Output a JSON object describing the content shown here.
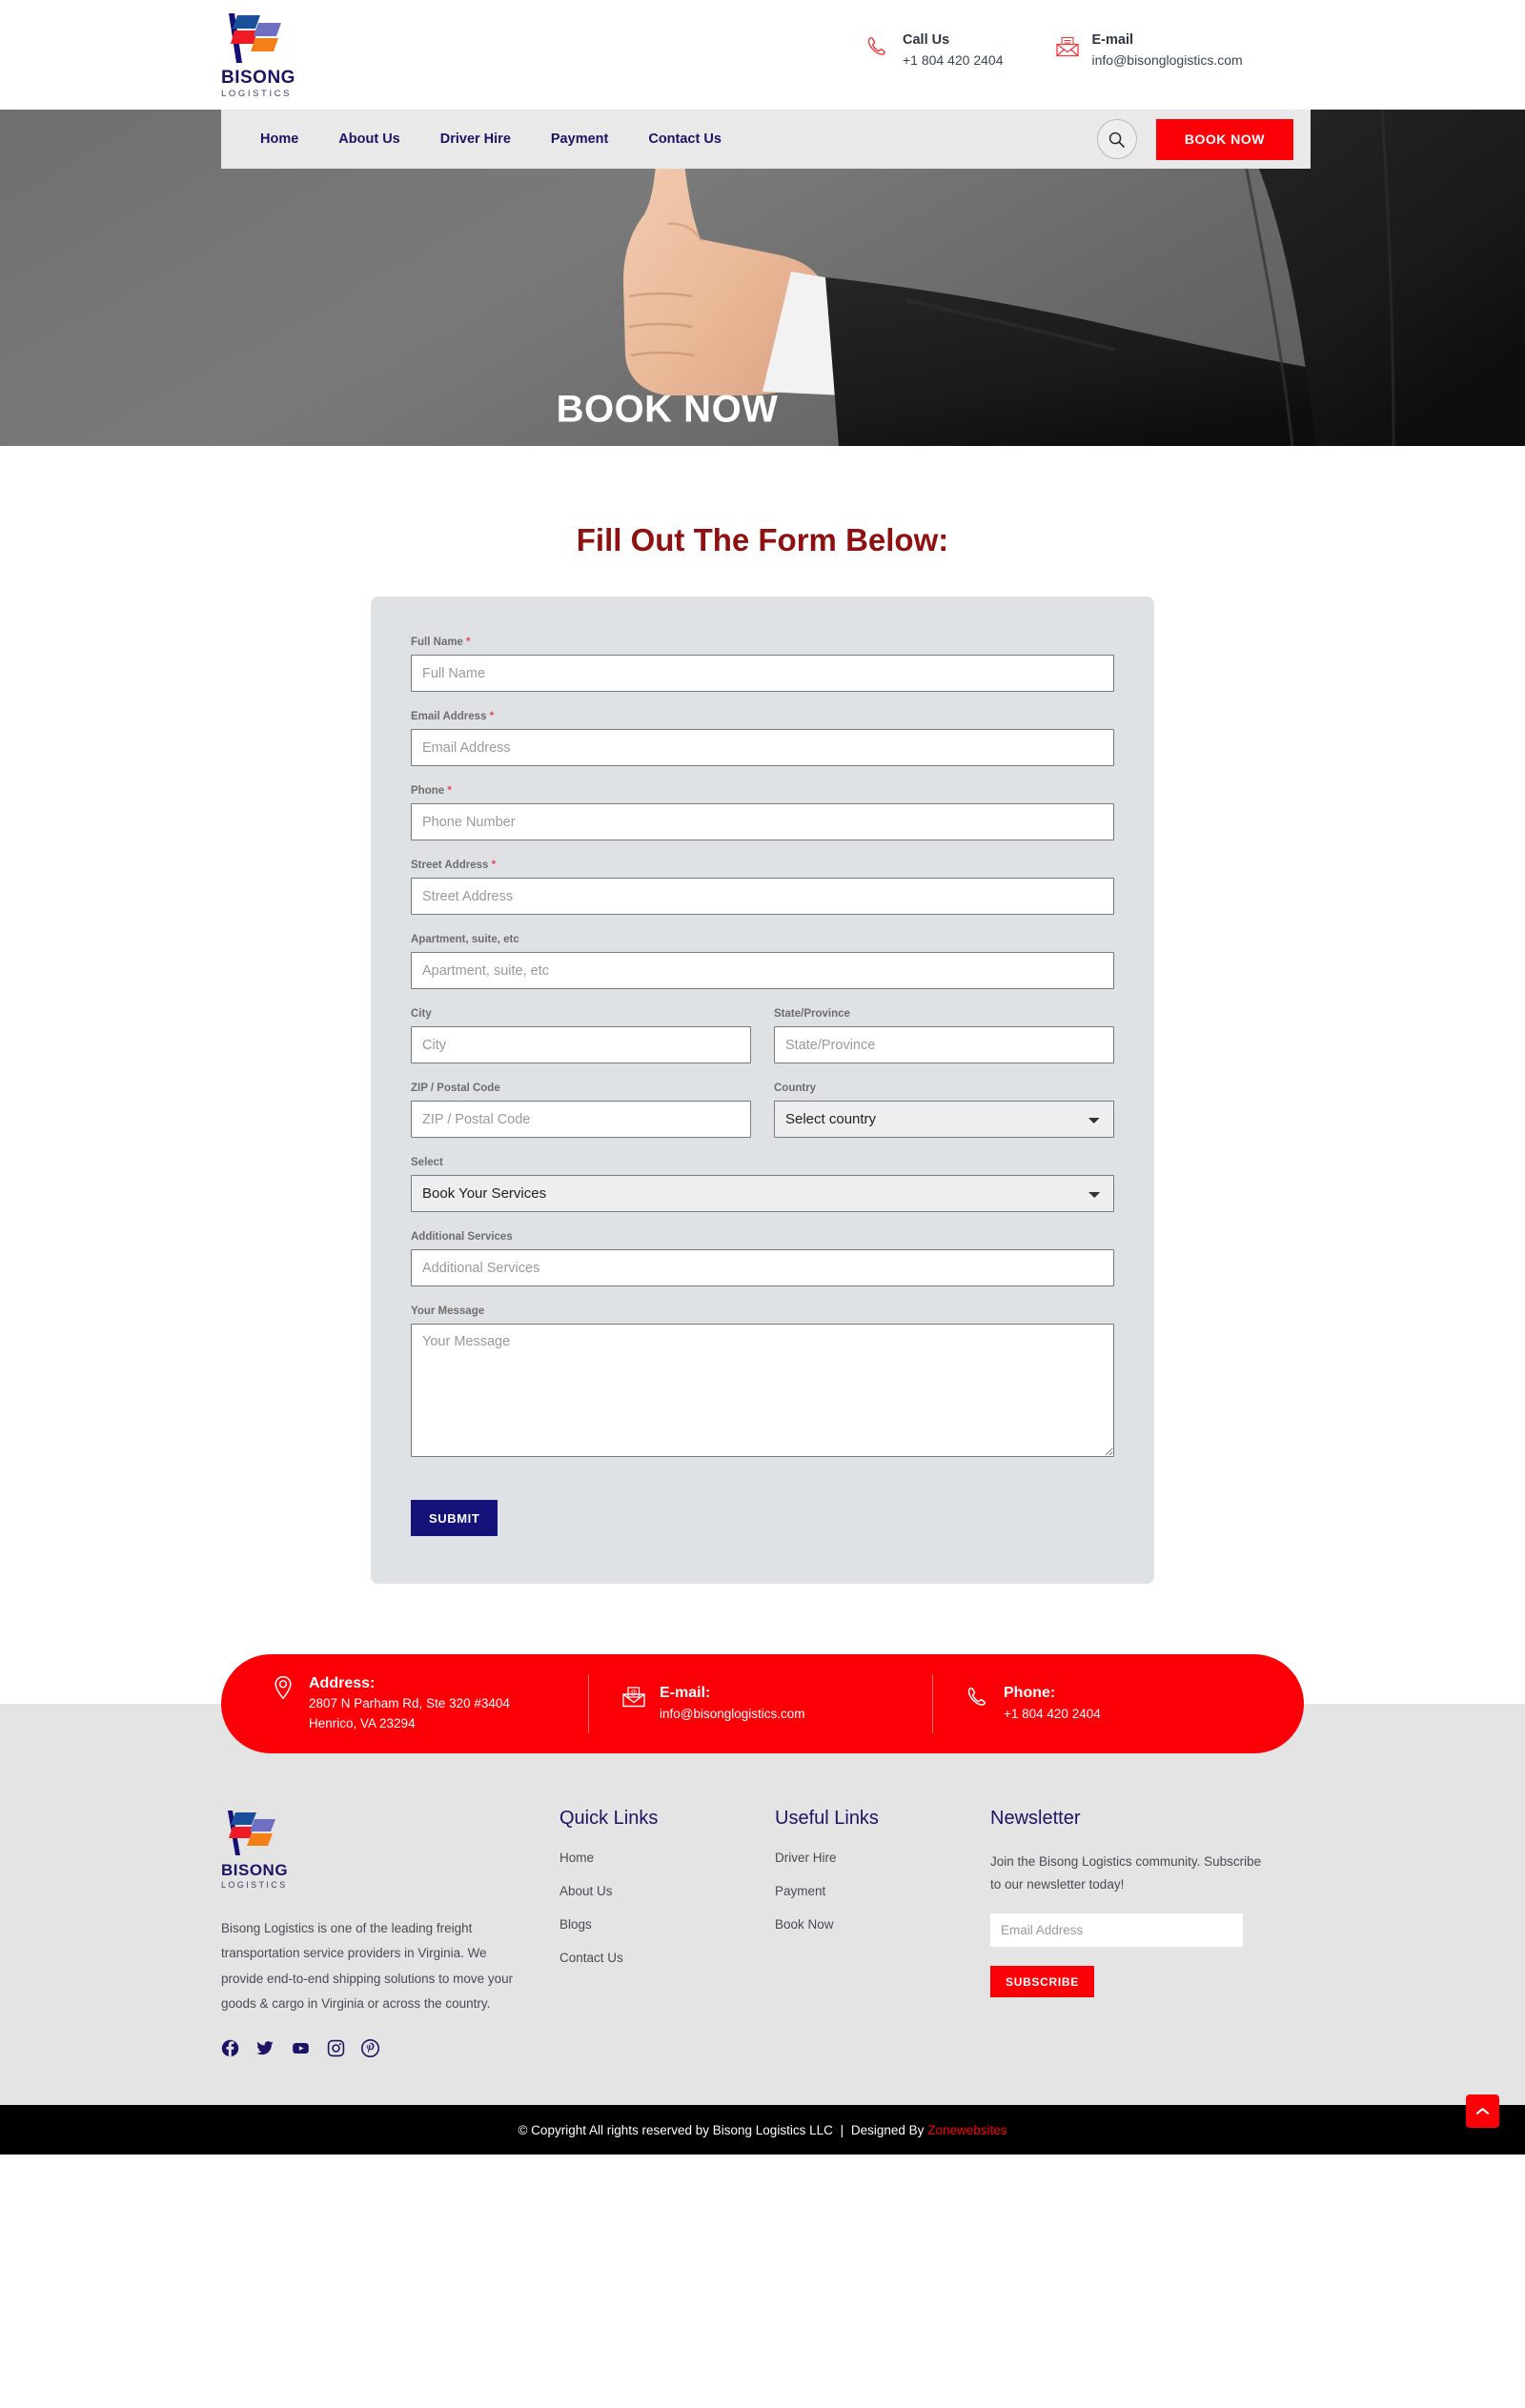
{
  "brand": {
    "name": "BISONG",
    "sub": "LOGISTICS"
  },
  "header": {
    "call": {
      "icon": "phone-icon",
      "title": "Call Us",
      "value": "+1 804 420 2404"
    },
    "email": {
      "icon": "envelope-icon",
      "title": "E-mail",
      "value": "info@bisonglogistics.com"
    }
  },
  "nav": {
    "items": [
      {
        "label": "Home"
      },
      {
        "label": "About Us"
      },
      {
        "label": "Driver Hire"
      },
      {
        "label": "Payment"
      },
      {
        "label": "Contact Us"
      }
    ],
    "search_icon": "search-icon",
    "book_now": "BOOK NOW"
  },
  "hero": {
    "title": "BOOK NOW"
  },
  "form": {
    "heading": "Fill Out The Form Below:",
    "fields": {
      "full_name": {
        "label": "Full Name",
        "required": true,
        "placeholder": "Full Name",
        "value": ""
      },
      "email": {
        "label": "Email Address",
        "required": true,
        "placeholder": "Email Address",
        "value": ""
      },
      "phone": {
        "label": "Phone",
        "required": true,
        "placeholder": "Phone Number",
        "value": ""
      },
      "street": {
        "label": "Street Address",
        "required": true,
        "placeholder": "Street Address",
        "value": ""
      },
      "apartment": {
        "label": "Apartment, suite, etc",
        "required": false,
        "placeholder": "Apartment, suite, etc",
        "value": ""
      },
      "city": {
        "label": "City",
        "required": false,
        "placeholder": "City",
        "value": ""
      },
      "state": {
        "label": "State/Province",
        "required": false,
        "placeholder": "State/Province",
        "value": ""
      },
      "zip": {
        "label": "ZIP / Postal Code",
        "required": false,
        "placeholder": "ZIP / Postal Code",
        "value": ""
      },
      "country": {
        "label": "Country",
        "required": false,
        "selected": "Select country",
        "options": [
          "Select country"
        ]
      },
      "select": {
        "label": "Select",
        "required": false,
        "selected": "Book Your Services",
        "options": [
          "Book Your Services"
        ]
      },
      "additional": {
        "label": "Additional Services",
        "required": false,
        "placeholder": "Additional Services",
        "value": ""
      },
      "message": {
        "label": "Your Message",
        "required": false,
        "placeholder": "Your Message",
        "value": ""
      }
    },
    "submit_label": "SUBMIT"
  },
  "contact_strip": {
    "address": {
      "icon": "location-pin-icon",
      "title": "Address:",
      "line1": "2807 N Parham Rd, Ste 320 #3404",
      "line2": "Henrico, VA 23294"
    },
    "email": {
      "icon": "envelope-at-icon",
      "title": "E-mail:",
      "value": "info@bisonglogistics.com"
    },
    "phone": {
      "icon": "phone-icon",
      "title": "Phone:",
      "value": "+1 804 420 2404"
    }
  },
  "footer": {
    "description": "Bisong Logistics is one of the leading freight transportation service providers in Virginia. We provide end-to-end shipping solutions to move your goods & cargo in Virginia or across the country.",
    "socials": [
      {
        "name": "facebook-icon"
      },
      {
        "name": "twitter-icon"
      },
      {
        "name": "youtube-icon"
      },
      {
        "name": "instagram-icon"
      },
      {
        "name": "pinterest-icon"
      }
    ],
    "quick_links": {
      "heading": "Quick Links",
      "items": [
        {
          "label": "Home"
        },
        {
          "label": "About Us"
        },
        {
          "label": "Blogs"
        },
        {
          "label": "Contact Us"
        }
      ]
    },
    "useful_links": {
      "heading": "Useful Links",
      "items": [
        {
          "label": "Driver Hire"
        },
        {
          "label": "Payment"
        },
        {
          "label": "Book Now"
        }
      ]
    },
    "newsletter": {
      "heading": "Newsletter",
      "text": "Join the Bisong Logistics community. Subscribe to our newsletter today!",
      "placeholder": "Email Address",
      "value": "",
      "button": "SUBSCRIBE"
    }
  },
  "copyright": {
    "text": "© Copyright All rights reserved by Bisong Logistics LLC",
    "separator": "|",
    "designed_by": "Designed By",
    "designer": "Zonewebsites",
    "to_top_icon": "chevron-up-icon"
  },
  "colors": {
    "accent_red": "#fb0007",
    "brand_navy": "#1b1464",
    "heading_maroon": "#8e1010",
    "submit_navy": "#15127a"
  }
}
